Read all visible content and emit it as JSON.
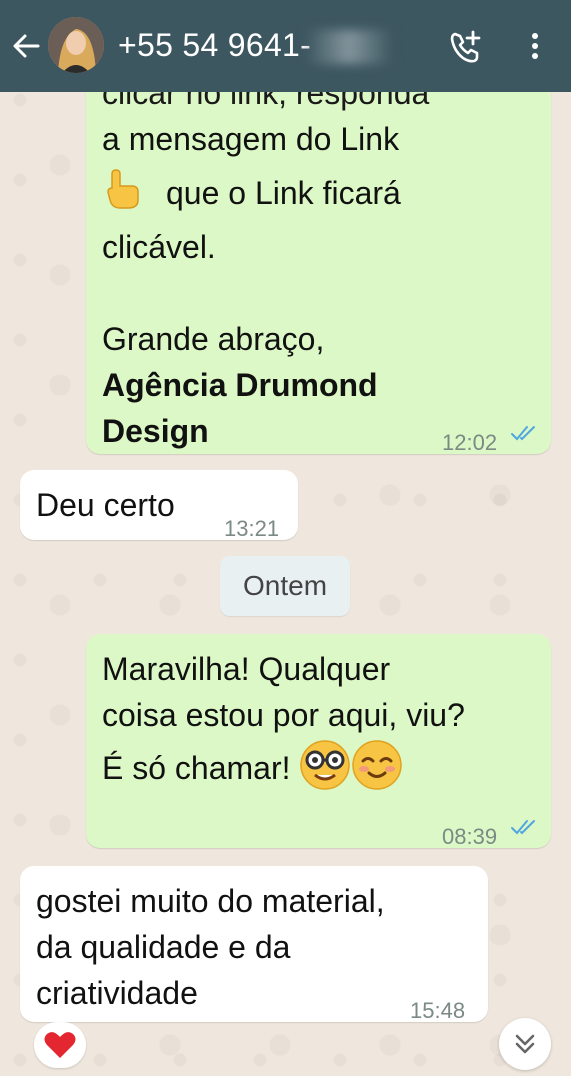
{
  "header": {
    "contact_name": "+55 54 9641-",
    "back_icon": "arrow-left-icon",
    "call_icon": "add-call-icon",
    "menu_icon": "more-vertical-icon"
  },
  "messages": [
    {
      "direction": "outgoing",
      "lines": [
        "clicar no link, responda",
        "a mensagem do Link",
        "que o Link ficará",
        "clicável.",
        "",
        "Grande abraço,"
      ],
      "bold_lines": [
        "Agência Drumond",
        "Design"
      ],
      "emoji": "backhand-index-pointing-up",
      "time": "12:02",
      "status": "read"
    },
    {
      "direction": "incoming",
      "lines": [
        "Deu certo"
      ],
      "time": "13:21"
    },
    {
      "direction": "outgoing",
      "lines": [
        "Maravilha! Qualquer",
        "coisa estou por aqui, viu?",
        "É só chamar!"
      ],
      "emoji": [
        "nerd-face",
        "smiling-face"
      ],
      "time": "08:39",
      "status": "read"
    },
    {
      "direction": "incoming",
      "lines": [
        "gostei muito do material,",
        "da qualidade e da",
        "criatividade"
      ],
      "time": "15:48",
      "reaction": "red-heart"
    }
  ],
  "date_divider": "Ontem",
  "colors": {
    "header": "#3d5761",
    "outgoing_bubble": "#dcf8c6",
    "incoming_bubble": "#ffffff",
    "read_ticks": "#4fa6e0"
  }
}
